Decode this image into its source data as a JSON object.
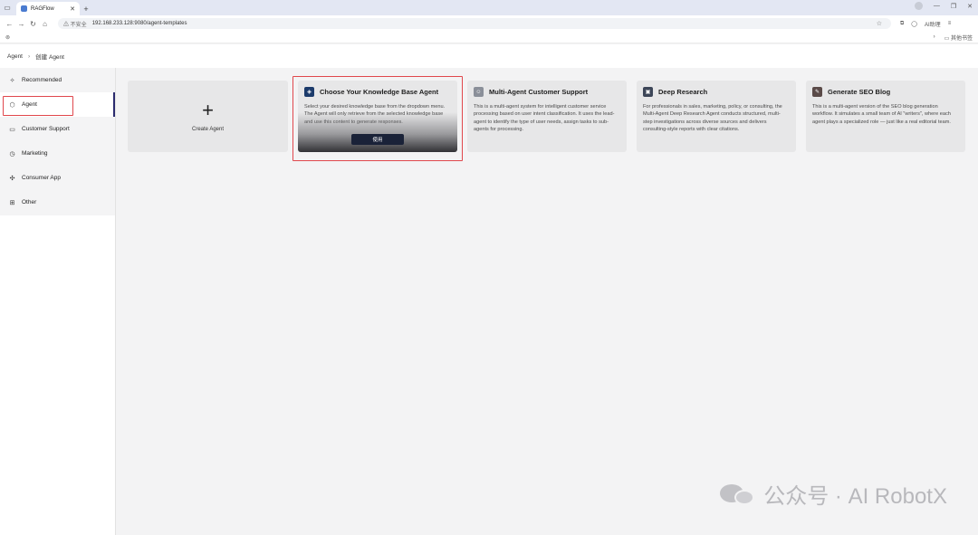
{
  "browser": {
    "tab_title": "RAGFlow",
    "new_tab": "+",
    "security_label": "不安全",
    "url": "192.168.233.128:9080/agent-templates",
    "ai_label": "AI助理",
    "bookmarks_label": "其他书签"
  },
  "header": {
    "breadcrumb_root": "Agent",
    "breadcrumb_sep": "›",
    "breadcrumb_current": "创建 Agent"
  },
  "sidebar": {
    "items": [
      {
        "label": "Recommended",
        "icon": "sparkle-icon"
      },
      {
        "label": "Agent",
        "icon": "cube-icon"
      },
      {
        "label": "Customer Support",
        "icon": "chat-icon"
      },
      {
        "label": "Marketing",
        "icon": "clock-icon"
      },
      {
        "label": "Consumer App",
        "icon": "crosshair-icon"
      },
      {
        "label": "Other",
        "icon": "apps-icon"
      }
    ]
  },
  "create_card": {
    "plus": "+",
    "label": "Create Agent"
  },
  "cards": [
    {
      "title": "Choose Your Knowledge Base Agent",
      "desc": "Select your desired knowledge base from the dropdown menu. The Agent will only retrieve from the selected knowledge base and use this content to generate responses.",
      "button": "使用",
      "icon_color": "#1c3b6b"
    },
    {
      "title": "Multi-Agent Customer Support",
      "desc": "This is a multi-agent system for intelligent customer service processing based on user intent classification. It uses the lead-agent to identify the type of user needs, assign tasks to sub-agents for processing.",
      "icon_color": "#8a8f99"
    },
    {
      "title": "Deep Research",
      "desc": "For professionals in sales, marketing, policy, or consulting, the Multi-Agent Deep Research Agent conducts structured, multi-step investigations across diverse sources and delivers consulting-style reports with clear citations.",
      "icon_color": "#3d4658"
    },
    {
      "title": "Generate SEO Blog",
      "desc": "This is a multi-agent version of the SEO blog generation workflow. It simulates a small team of AI \"writers\", where each agent plays a specialized role — just like a real editorial team.",
      "icon_color": "#5a4a48"
    }
  ],
  "watermark": {
    "text": "公众号 · AI RobotX"
  },
  "colors": {
    "accent": "#2b2b6e",
    "highlight": "#e0474c",
    "button": "#1a2238"
  }
}
